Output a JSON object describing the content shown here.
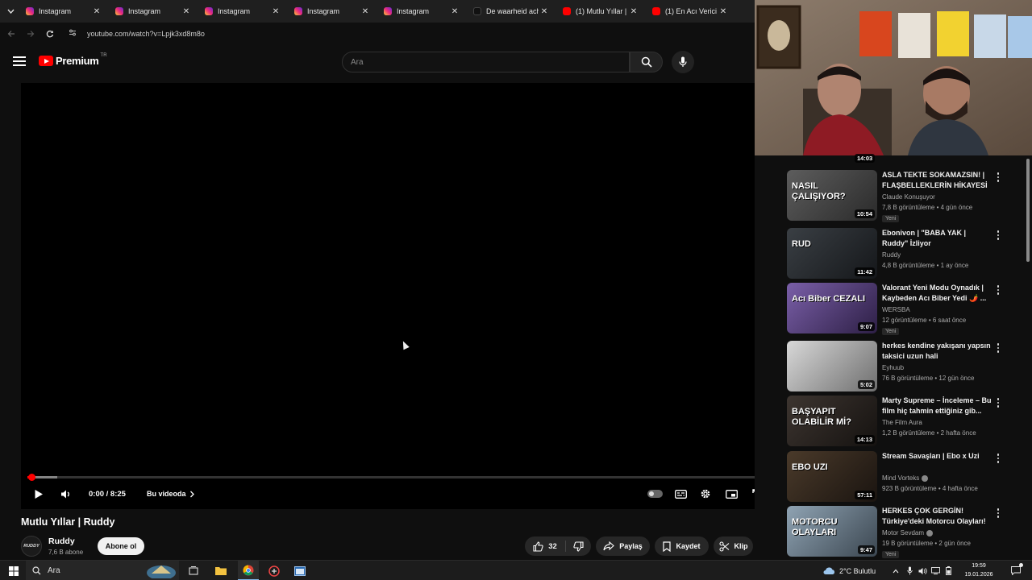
{
  "browser": {
    "tabs": [
      {
        "label": "Instagram",
        "favicon": "instagram-icon",
        "type": "ig"
      },
      {
        "label": "Instagram",
        "favicon": "instagram-icon",
        "type": "ig"
      },
      {
        "label": "Instagram",
        "favicon": "instagram-icon",
        "type": "ig"
      },
      {
        "label": "Instagram",
        "favicon": "instagram-icon",
        "type": "ig"
      },
      {
        "label": "Instagram",
        "favicon": "instagram-icon",
        "type": "ig"
      },
      {
        "label": "De waarheid acht",
        "favicon": "tiktok-icon",
        "type": "tt"
      },
      {
        "label": "(1) Mutlu Yıllar | R",
        "favicon": "youtube-icon",
        "type": "yt"
      },
      {
        "label": "(1) En Acı Verici G",
        "favicon": "youtube-icon",
        "type": "yt"
      }
    ],
    "url": "youtube.com/watch?v=Lpjk3xd8m8o"
  },
  "header": {
    "logo_text": "Premium",
    "country_code": "TR",
    "search_placeholder": "Ara"
  },
  "player": {
    "current_time": "0:00",
    "duration": "8:25",
    "time_display": "0:00 / 8:25",
    "chapter_label": "Bu videoda",
    "progress_fraction": 0.005,
    "buffer_fraction": 0.04
  },
  "video": {
    "title": "Mutlu Yıllar | Ruddy",
    "channel_name": "Ruddy",
    "channel_avatar_text": "RUDDY",
    "subscribers": "7,6 B abone",
    "subscribe_label": "Abone ol",
    "like_count": "32",
    "share_label": "Paylaş",
    "save_label": "Kaydet",
    "clip_label": "Klip"
  },
  "related": {
    "partial_top_duration": "14:03",
    "items": [
      {
        "title": "ASLA TEKTE SOKAMAZSIN! | FLAŞBELLEKLERİN HİKAYESİ",
        "channel": "Claude Konuşuyor",
        "verified": false,
        "meta": "7,8 B görüntüleme • 4 gün önce",
        "duration": "10:54",
        "badge": "Yeni",
        "thumb_text": "NASIL ÇALIŞIYOR?",
        "colors": [
          "#5d5d5d",
          "#2a2a2a"
        ]
      },
      {
        "title": "Ebonivon | \"BABA YAK | Ruddy\" İzliyor",
        "channel": "Ruddy",
        "verified": false,
        "meta": "4,8 B görüntüleme • 1 ay önce",
        "duration": "11:42",
        "badge": "",
        "thumb_text": "RUD",
        "colors": [
          "#3a3f44",
          "#15171a"
        ]
      },
      {
        "title": "Valorant Yeni Modu Oynadık | Kaybeden Acı Biber Yedi 🌶️ ...",
        "channel": "WERSBA",
        "verified": false,
        "meta": "12 görüntüleme • 6 saat önce",
        "duration": "9:07",
        "badge": "Yeni",
        "thumb_text": "Acı Biber CEZALI",
        "colors": [
          "#7a5fa8",
          "#2d1f45"
        ]
      },
      {
        "title": "herkes kendine yakışanı yapsın taksici uzun hali",
        "channel": "Eyhuub",
        "verified": false,
        "meta": "76 B görüntüleme • 12 gün önce",
        "duration": "5:02",
        "badge": "",
        "thumb_text": "",
        "colors": [
          "#d8d8d8",
          "#6f6f6f"
        ]
      },
      {
        "title": "Marty Supreme – İnceleme – Bu film hiç tahmin ettiğiniz gib...",
        "channel": "The Film Aura",
        "verified": false,
        "meta": "1,2 B görüntüleme • 2 hafta önce",
        "duration": "14:13",
        "badge": "",
        "thumb_text": "BAŞYAPIT OLABİLİR Mİ?",
        "colors": [
          "#3d3530",
          "#151210"
        ]
      },
      {
        "title": "Stream Savaşları | Ebo x Uzi",
        "channel": "Mind Vorteks",
        "verified": true,
        "meta": "923 B görüntüleme • 4 hafta önce",
        "duration": "57:11",
        "badge": "",
        "thumb_text": "EBO UZI",
        "colors": [
          "#4a3a2a",
          "#1a1410"
        ]
      },
      {
        "title": "HERKES ÇOK GERGİN! Türkiye'deki Motorcu Olayları! ...",
        "channel": "Motor Sevdam",
        "verified": true,
        "meta": "19 B görüntüleme • 2 gün önce",
        "duration": "9:47",
        "badge": "Yeni",
        "thumb_text": "MOTORCU OLAYLARI",
        "colors": [
          "#8fa3b3",
          "#3b4650"
        ]
      }
    ]
  },
  "taskbar": {
    "search_label": "Ara",
    "weather": "2°C  Bulutlu",
    "time": "19:59",
    "date": "19.01.2026"
  }
}
